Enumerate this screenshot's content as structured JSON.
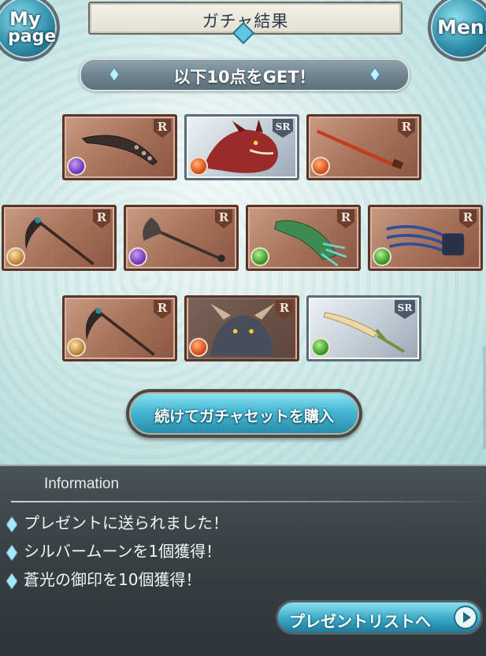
{
  "header": {
    "title": "ガチャ結果",
    "mypage_line1": "My",
    "mypage_line2": "page",
    "menu_label": "Menu"
  },
  "result_banner": "以下10点をGET！",
  "cards": [
    {
      "rarity": "R",
      "element": "dark",
      "item": "dark-blade-weapon"
    },
    {
      "rarity": "SR",
      "element": "fire",
      "item": "red-dragon-summon"
    },
    {
      "rarity": "R",
      "element": "fire",
      "item": "red-spear-weapon"
    },
    {
      "rarity": "R",
      "element": "earth",
      "item": "scythe-staff-weapon"
    },
    {
      "rarity": "R",
      "element": "dark",
      "item": "battle-axe-weapon"
    },
    {
      "rarity": "R",
      "element": "wind",
      "item": "green-gauntlet-weapon"
    },
    {
      "rarity": "R",
      "element": "wind",
      "item": "blue-claw-weapon"
    },
    {
      "rarity": "R",
      "element": "earth",
      "item": "scythe-staff-weapon"
    },
    {
      "rarity": "R",
      "element": "fire",
      "item": "horned-beast-summon"
    },
    {
      "rarity": "SR",
      "element": "wind",
      "item": "golden-dagger-weapon"
    }
  ],
  "cta_label": "続けてガチャセットを購入",
  "info": {
    "title": "Information",
    "messages": [
      "プレゼントに送られました！",
      "シルバームーンを1個獲得！",
      "蒼光の御印を10個獲得！"
    ],
    "present_button": "プレゼントリストへ"
  },
  "colors": {
    "accent": "#46b8d4",
    "card_r": "#a8735c",
    "card_sr": "#c6d0d8",
    "panel": "#3a4245"
  }
}
